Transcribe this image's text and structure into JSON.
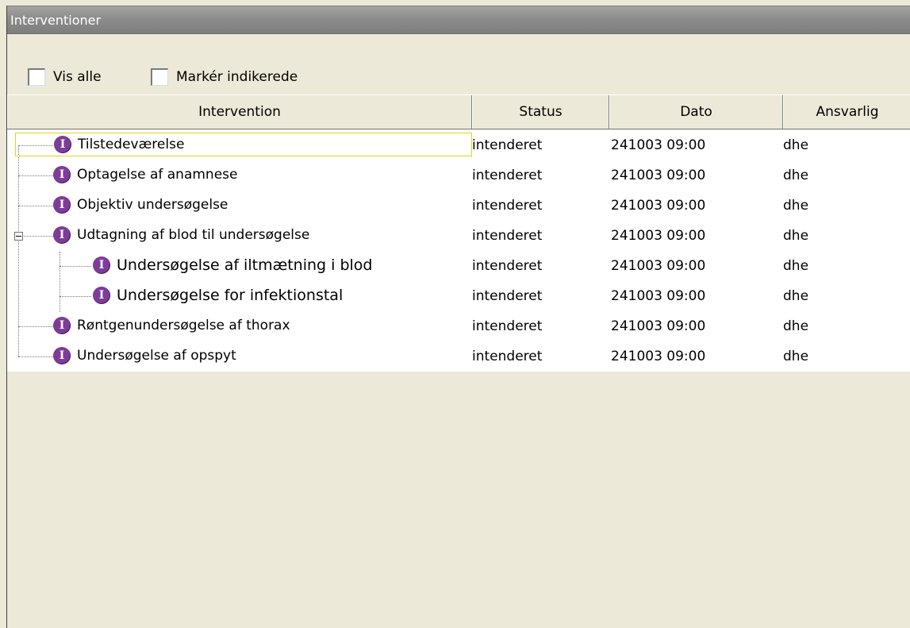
{
  "panel": {
    "title": "Interventioner"
  },
  "options": {
    "show_all": {
      "label": "Vis alle",
      "checked": false
    },
    "mark_indicated": {
      "label": "Markér indikerede",
      "checked": false
    }
  },
  "table": {
    "columns": [
      "Intervention",
      "Status",
      "Dato",
      "Ansvarlig"
    ],
    "badge_letter": "I",
    "badge_color": "#7d3c98",
    "rows": [
      {
        "name": "Tilstedeværelse",
        "status": "intenderet",
        "date": "241003 09:00",
        "responsible": "dhe",
        "level": 0,
        "selected": true
      },
      {
        "name": "Optagelse af anamnese",
        "status": "intenderet",
        "date": "241003 09:00",
        "responsible": "dhe",
        "level": 0
      },
      {
        "name": "Objektiv undersøgelse",
        "status": "intenderet",
        "date": "241003 09:00",
        "responsible": "dhe",
        "level": 0
      },
      {
        "name": "Udtagning af blod til undersøgelse",
        "status": "intenderet",
        "date": "241003 09:00",
        "responsible": "dhe",
        "level": 0,
        "expanded": true
      },
      {
        "name": "Undersøgelse af iltmætning i blod",
        "status": "intenderet",
        "date": "241003 09:00",
        "responsible": "dhe",
        "level": 1
      },
      {
        "name": "Undersøgelse for infektionstal",
        "status": "intenderet",
        "date": "241003 09:00",
        "responsible": "dhe",
        "level": 1
      },
      {
        "name": "Røntgenundersøgelse af thorax",
        "status": "intenderet",
        "date": "241003 09:00",
        "responsible": "dhe",
        "level": 0
      },
      {
        "name": "Undersøgelse af opspyt",
        "status": "intenderet",
        "date": "241003 09:00",
        "responsible": "dhe",
        "level": 0
      }
    ]
  }
}
